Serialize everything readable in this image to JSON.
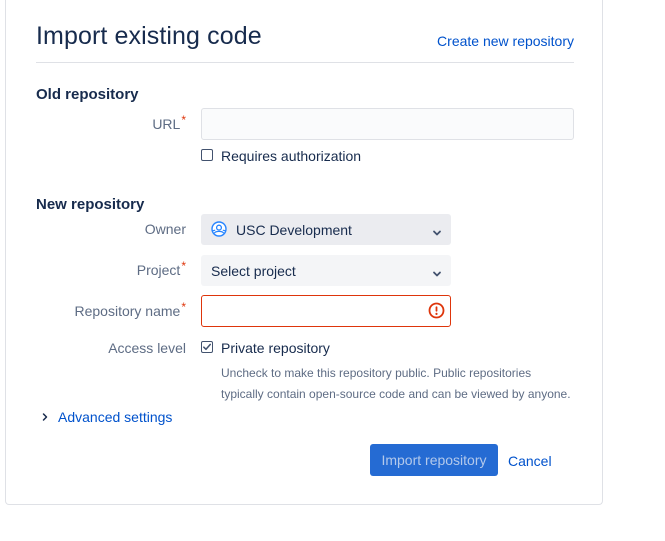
{
  "header": {
    "title": "Import existing code",
    "create_link": "Create new repository"
  },
  "old_repo": {
    "heading": "Old repository",
    "url_label": "URL",
    "url_required": "*",
    "url_value": "",
    "requires_auth_label": "Requires authorization",
    "requires_auth_checked": false
  },
  "new_repo": {
    "heading": "New repository",
    "owner_label": "Owner",
    "owner_value": "USC Development",
    "project_label": "Project",
    "project_required": "*",
    "project_value": "Select project",
    "repo_name_label": "Repository name",
    "repo_name_required": "*",
    "repo_name_value": "",
    "access_label": "Access level",
    "private_label": "Private repository",
    "private_checked": true,
    "help_line1": "Uncheck to make this repository public. Public repositories",
    "help_line2": "typically contain open-source code and can be viewed by anyone."
  },
  "advanced": {
    "label": "Advanced settings"
  },
  "actions": {
    "import_label": "Import repository",
    "cancel_label": "Cancel"
  },
  "colors": {
    "link": "#0052cc",
    "error": "#de350b",
    "primary": "#0052cc"
  }
}
